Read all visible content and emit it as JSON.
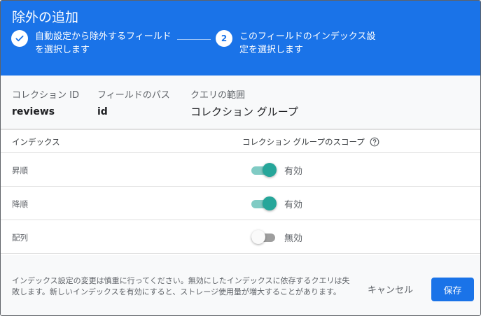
{
  "dialog": {
    "title": "除外の追加",
    "steps": [
      {
        "label": "自動設定から除外するフィールドを選択します",
        "done": true,
        "icon": "check-icon"
      },
      {
        "number": "2",
        "label": "このフィールドのインデックス設定を選択します"
      }
    ]
  },
  "info": {
    "collection_id_label": "コレクション ID",
    "collection_id_value": "reviews",
    "field_path_label": "フィールドのパス",
    "field_path_value": "id",
    "query_scope_label": "クエリの範囲",
    "query_scope_value": "コレクション グループ"
  },
  "table": {
    "col_index": "インデックス",
    "col_scope": "コレクション グループのスコープ",
    "help_icon": "help-circle-icon",
    "rows": [
      {
        "label": "昇順",
        "enabled": true,
        "state": "有効"
      },
      {
        "label": "降順",
        "enabled": true,
        "state": "有効"
      },
      {
        "label": "配列",
        "enabled": false,
        "state": "無効"
      }
    ]
  },
  "footer": {
    "note": "インデックス設定の変更は慎重に行ってください。無効にしたインデックスに依存するクエリは失敗します。新しいインデックスを有効にすると、ストレージ使用量が増大することがあります。",
    "cancel_label": "キャンセル",
    "save_label": "保存"
  },
  "colors": {
    "primary": "#1a73e8",
    "toggle_on": "#26a69a",
    "toggle_on_track": "#80cbc4",
    "toggle_off_track": "#9e9e9e"
  }
}
